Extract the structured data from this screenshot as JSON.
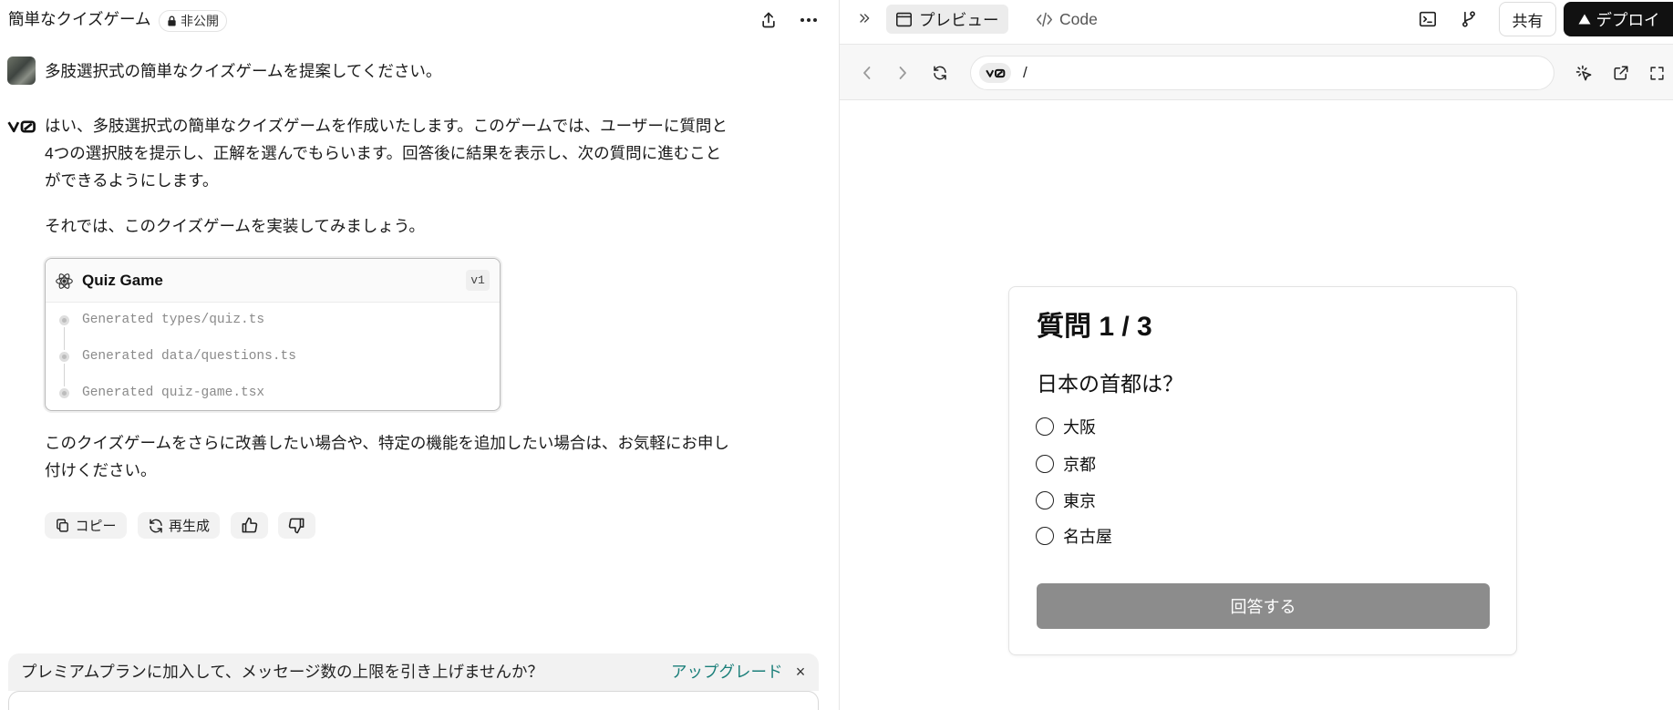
{
  "left": {
    "header": {
      "title": "簡単なクイズゲーム",
      "visibility_badge": "非公開",
      "icons": [
        "lock-icon",
        "share-icon",
        "more-icon"
      ]
    },
    "user_message": "多肢選択式の簡単なクイズゲームを提案してください。",
    "assistant": {
      "paragraph1_lines": [
        "はい、多肢選択式の簡単なクイズゲームを作成いたします。このゲームでは、ユーザーに質問と",
        "4つの選択肢を提示し、正解を選んでもらいます。回答後に結果を表示し、次の質問に進むこと",
        "ができるようにします。"
      ],
      "paragraph2": "それでは、このクイズゲームを実装してみましょう。",
      "card": {
        "title": "Quiz Game",
        "version": "v1",
        "icon": "react-icon",
        "steps": [
          "Generated types/quiz.ts",
          "Generated data/questions.ts",
          "Generated quiz-game.tsx"
        ]
      },
      "paragraph3_lines": [
        "このクイズゲームをさらに改善したい場合や、特定の機能を追加したい場合は、お気軽にお申し",
        "付けください。"
      ]
    },
    "actions": {
      "copy_label": "コピー",
      "regenerate_label": "再生成",
      "icons": [
        "copy-icon",
        "refresh-icon",
        "thumbs-up-icon",
        "thumbs-down-icon"
      ]
    },
    "banner": {
      "text": "プレミアムプランに加入して、メッセージ数の上限を引き上げませんか？",
      "link": "アップグレード",
      "close": "×"
    }
  },
  "right": {
    "tabs": [
      {
        "label": "プレビュー",
        "active": true,
        "icon": "browser-window-icon"
      },
      {
        "label": "Code",
        "active": false,
        "icon": "code-icon"
      }
    ],
    "toolbar": {
      "share_label": "共有",
      "deploy_label": "デプロイ",
      "icons": [
        "collapse-icon",
        "terminal-icon",
        "fork-icon",
        "triangle-icon"
      ]
    },
    "browser": {
      "url_path": "/",
      "icons": [
        "back-icon",
        "forward-icon",
        "reload-icon",
        "select-element-icon",
        "external-link-icon",
        "fullscreen-icon"
      ]
    },
    "quiz": {
      "heading": "質問 1 / 3",
      "question": "日本の首都は？",
      "options": [
        "大阪",
        "京都",
        "東京",
        "名古屋"
      ],
      "selected": null,
      "submit_label": "回答する"
    }
  },
  "colors": {
    "text": "#1a1a1a",
    "link": "#1b7f7a",
    "deploy_bg": "#111111",
    "submit_bg": "#8c8c8c",
    "banner_bg": "#f2f2f2"
  }
}
